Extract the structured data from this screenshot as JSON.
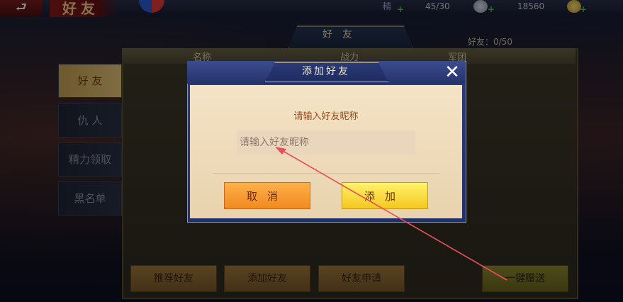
{
  "topbar": {
    "back_glyph": "⮐",
    "title": "好友",
    "resources": [
      {
        "icon": "stamina-icon",
        "value": "45/30"
      },
      {
        "icon": "silver-icon",
        "value": "18560"
      },
      {
        "icon": "gold-icon",
        "value": ""
      }
    ],
    "partial_label": "精"
  },
  "page": {
    "tab_title": "好友",
    "friend_count": "好友：0/50",
    "columns": [
      "名称",
      "战力",
      "军团"
    ]
  },
  "sidebar": {
    "items": [
      {
        "label": "好 友",
        "active": true
      },
      {
        "label": "仇 人",
        "active": false
      },
      {
        "label": "精力领取",
        "active": false
      },
      {
        "label": "黑名单",
        "active": false
      }
    ]
  },
  "bottom": {
    "recommend": "推荐好友",
    "add": "添加好友",
    "requests": "好友申请",
    "gift": "一键赠送"
  },
  "dialog": {
    "title": "添加好友",
    "close_glyph": "✕",
    "prompt": "请输入好友昵称",
    "input_value": "",
    "input_placeholder": "请输入好友昵称",
    "cancel": "取消",
    "add": "添加"
  },
  "colors": {
    "dialog_header": "#2c3c78",
    "dialog_body": "#f4e3c6",
    "cancel_button": "#f8a23a",
    "add_button": "#fbe04a",
    "annotation_arrow": "#e8505a"
  }
}
